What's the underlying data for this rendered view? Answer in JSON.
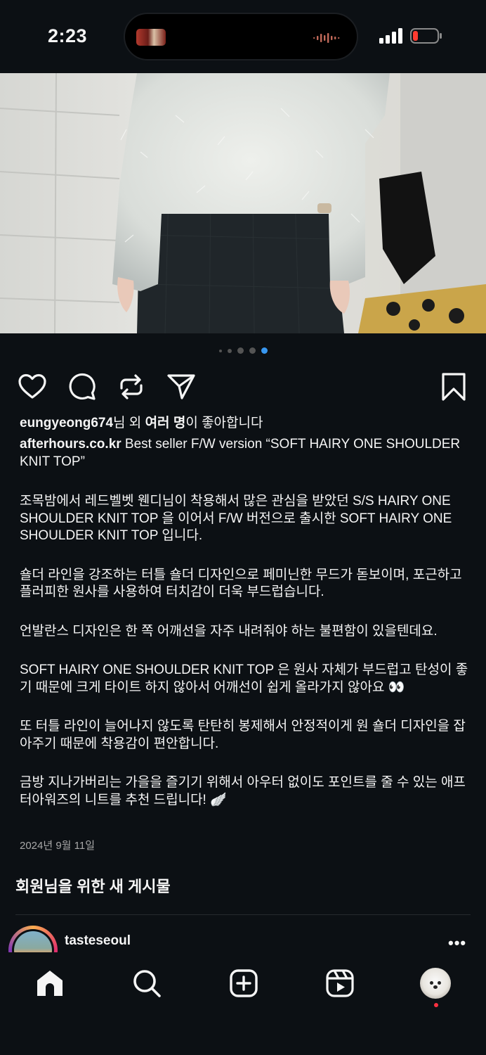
{
  "status_bar": {
    "time": "2:23"
  },
  "carousel": {
    "count": 5,
    "active_index": 4
  },
  "post": {
    "likes": {
      "user": "eungyeong674",
      "mid": "님 외 ",
      "others": "여러 명",
      "tail": "이 좋아합니다"
    },
    "caption": {
      "username": "afterhours.co.kr",
      "title": " Best seller F/W version “SOFT HAIRY ONE SHOULDER KNIT TOP”",
      "paragraphs": [
        "조목밤에서 레드벨벳 웬디님이 착용해서 많은 관심을 받았던 S/S HAIRY ONE SHOULDER KNIT TOP 을 이어서 F/W 버전으로 출시한 SOFT HAIRY ONE SHOULDER KNIT TOP 입니다.",
        "숄더 라인을 강조하는 터틀 숄더 디자인으로 페미닌한 무드가 돋보이며, 포근하고 플러피한 원사를 사용하여 터치감이 더욱 부드럽습니다.",
        "언발란스 디자인은 한 쪽 어깨선을 자주 내려줘야 하는 불편함이 있을텐데요.",
        "SOFT HAIRY ONE SHOULDER KNIT TOP 은 원사 자체가 부드럽고 탄성이 좋기 때문에 크게 타이트 하지 않아서 어깨선이 쉽게 올라가지 않아요 👀",
        "또 터틀 라인이 늘어나지 않도록 탄탄히 봉제해서 안정적이게 원 숄더 디자인을 잡아주기 때문에 착용감이 편안합니다.",
        "금방 지나가버리는 가을을 즐기기 위해서 아우터 없이도 포인트를 줄 수 있는 애프터아워즈의 니트를 추천 드립니다! 🪽"
      ]
    },
    "date": "2024년 9월 11일"
  },
  "section_title": "회원님을 위한 새 게시물",
  "next_post": {
    "username": "tasteseoul"
  },
  "icons": {
    "like": "heart-icon",
    "comment": "comment-icon",
    "repost": "repost-icon",
    "share": "send-icon",
    "save": "bookmark-icon",
    "home": "home-icon",
    "search": "search-icon",
    "create": "create-icon",
    "reels": "reels-icon",
    "profile": "profile-avatar"
  },
  "colors": {
    "background": "#0c1014",
    "text": "#f5f5f5",
    "muted": "#a8a8a8",
    "active_dot": "#3897f0",
    "notification": "#ff3040",
    "battery_low": "#ff3b30"
  }
}
